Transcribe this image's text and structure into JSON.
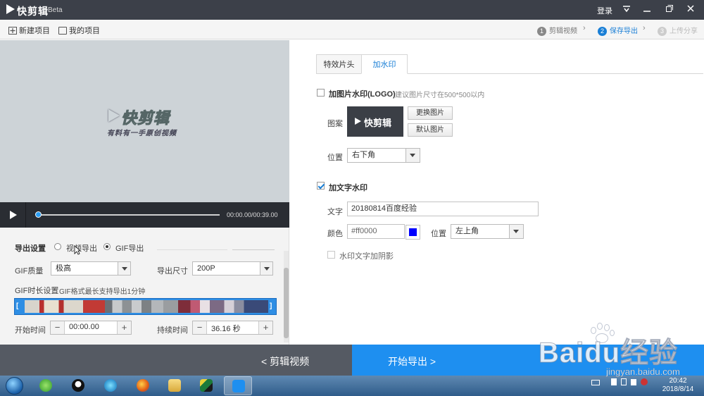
{
  "titlebar": {
    "app_name": "快剪辑",
    "beta": "Beta",
    "login": "登录"
  },
  "toolbar": {
    "new_project": "新建项目",
    "my_projects": "我的项目",
    "steps": [
      {
        "num": "1",
        "label": "剪辑视频",
        "state": "done"
      },
      {
        "num": "2",
        "label": "保存导出",
        "state": "active"
      },
      {
        "num": "3",
        "label": "上传分享",
        "state": "disabled"
      }
    ]
  },
  "preview": {
    "watermark_title": "快剪辑",
    "watermark_slogan": "有料有一手原创视频",
    "timecode": "00:00.00/00:39.00",
    "progress": 0.0
  },
  "export": {
    "section_label": "导出设置",
    "mode_video": "视频导出",
    "mode_gif": "GIF导出",
    "selected_mode": "gif",
    "gif_quality_label": "GIF质量",
    "gif_quality_value": "极高",
    "size_label": "导出尺寸",
    "size_value": "200P",
    "duration_setting_label": "GIF时长设置",
    "duration_hint": "GIF格式最长支持导出1分钟",
    "start_label": "开始时间",
    "start_value": "00:00.00",
    "duration_label": "持续时间",
    "duration_value": "36.16 秒"
  },
  "watermark": {
    "tabs": [
      {
        "label": "特效片头"
      },
      {
        "label": "加水印"
      }
    ],
    "active_tab": 1,
    "image_wm_label": "加图片水印(LOGO)",
    "image_wm_hint": "建议图片尺寸在500*500以内",
    "image_wm_checked": false,
    "pattern_label": "图案",
    "logo_text": "快剪辑",
    "replace_image": "更换图片",
    "default_image": "默认图片",
    "position_label": "位置",
    "image_position": "右下角",
    "text_wm_label": "加文字水印",
    "text_wm_checked": true,
    "text_label": "文字",
    "text_value": "20180814百度经验",
    "color_label": "颜色",
    "color_value": "#ff0000",
    "swatch_color": "#0000ff",
    "text_position_label": "位置",
    "text_position": "左上角",
    "shadow_label": "水印文字加阴影",
    "shadow_checked": false
  },
  "bottom": {
    "back": "< 剪辑视频",
    "start_export": "开始导出 >"
  },
  "taskbar": {
    "time": "20:42",
    "date": "2018/8/14"
  },
  "baidu_watermark": {
    "brand": "Baidu经验",
    "url": "jingyan.baidu.com"
  }
}
